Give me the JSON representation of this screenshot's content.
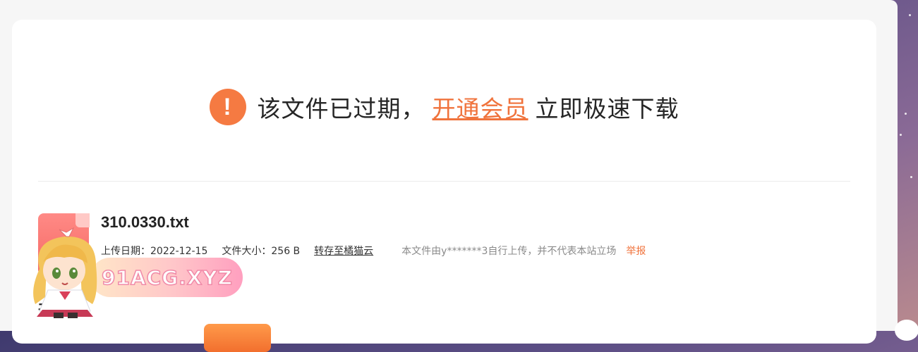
{
  "notice": {
    "icon": "exclamation-circle-icon",
    "icon_glyph": "!",
    "text_before": "该文件已过期，",
    "vip_link": "开通会员",
    "text_after": "立即极速下载"
  },
  "file": {
    "icon": "document-file-icon",
    "name": "310.0330.txt",
    "upload_date": "上传日期：2022-12-15",
    "file_size": "文件大小：256 B",
    "save_link": "转存至橘猫云",
    "uploader_note": "本文件由y*******3自行上传，并不代表本站立场",
    "report_link": "举报"
  },
  "partial_heading": "开",
  "watermark": {
    "text": "91ACG.XYZ",
    "mascot_icon": "anime-mascot-icon"
  },
  "colors": {
    "accent": "#f57a42",
    "link": "#f0733c",
    "file_icon": "#f56863"
  }
}
